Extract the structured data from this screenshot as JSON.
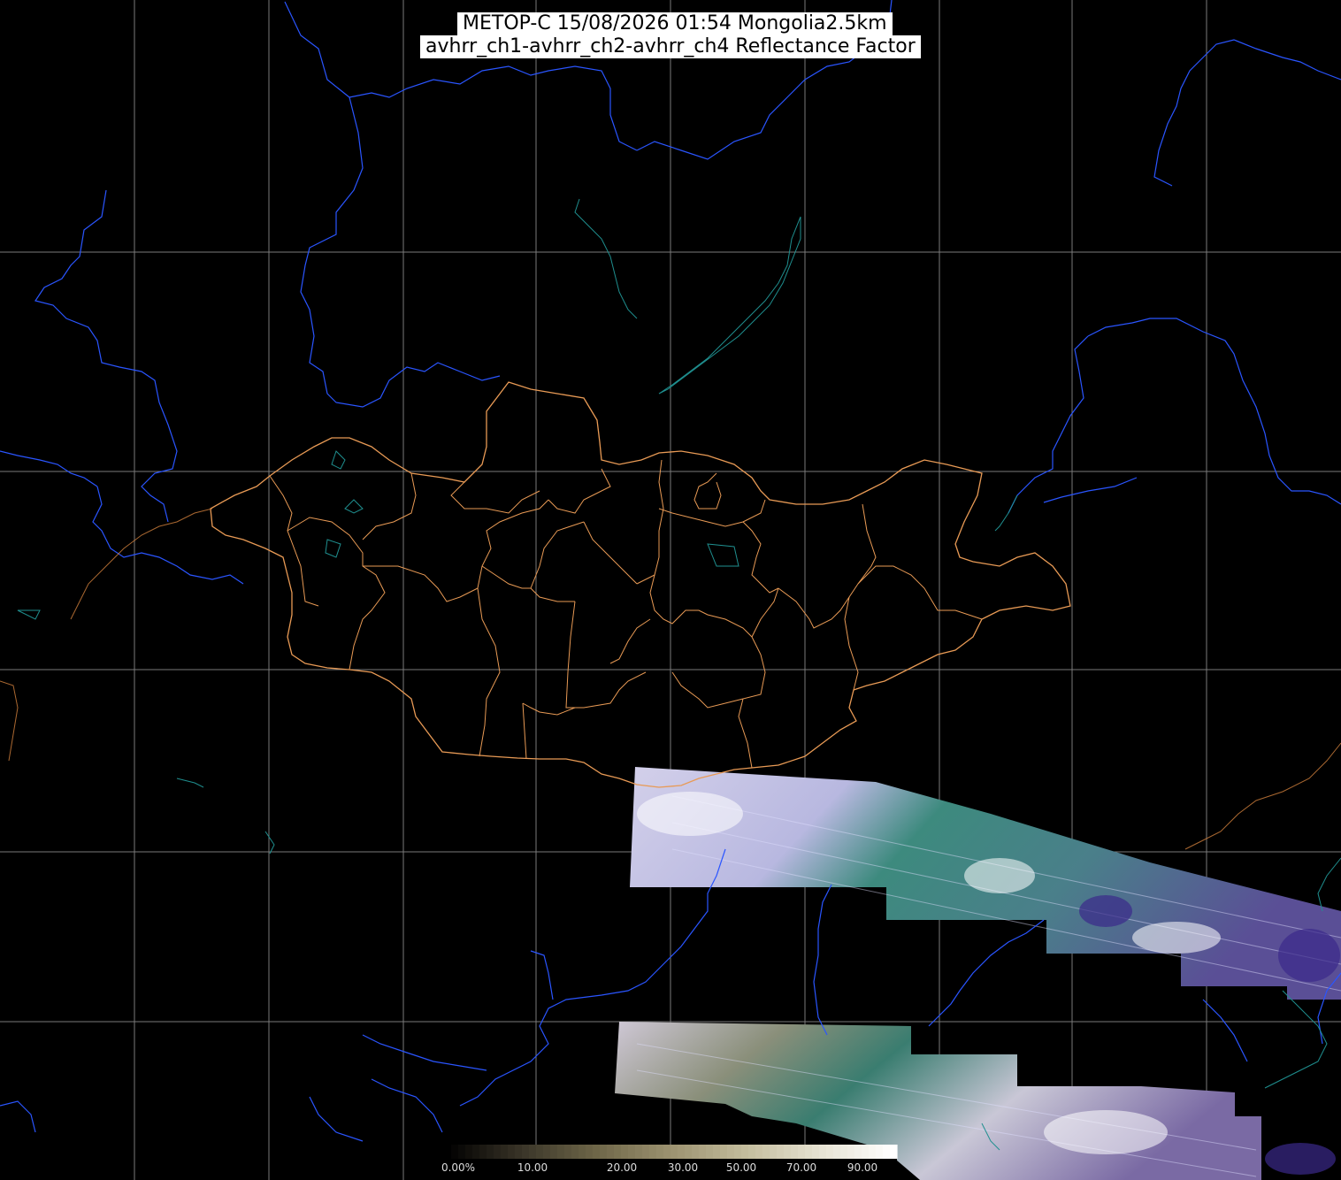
{
  "title": {
    "line1": "METOP-C 15/08/2026 01:54 Mongolia2.5km",
    "line2": "avhrr_ch1-avhrr_ch2-avhrr_ch4 Reflectance Factor"
  },
  "map": {
    "satellite": "METOP-C",
    "region": "Mongolia",
    "composite": "avhrr_ch1-avhrr_ch2-avhrr_ch4 Reflectance Factor",
    "layers": [
      "lat-lon grid",
      "coastlines",
      "rivers",
      "national border",
      "province borders",
      "satellite swath imagery"
    ],
    "colors": {
      "background": "#000000",
      "grid": "#808080",
      "coastline": "#2a55ff",
      "lakes": "#1f8f8f",
      "borders": "#e89a55",
      "imagery_cloud": "#cfcbe8",
      "imagery_land": "#3a8078"
    }
  },
  "legend": {
    "ticks": [
      "0.00%",
      "10.00",
      "20.00",
      "30.00",
      "50.00",
      "70.00",
      "90.00"
    ],
    "colors": [
      "#000000",
      "#3a3528",
      "#6e6648",
      "#9c9270",
      "#c3bc9c",
      "#e6e2d2",
      "#ffffff"
    ]
  }
}
